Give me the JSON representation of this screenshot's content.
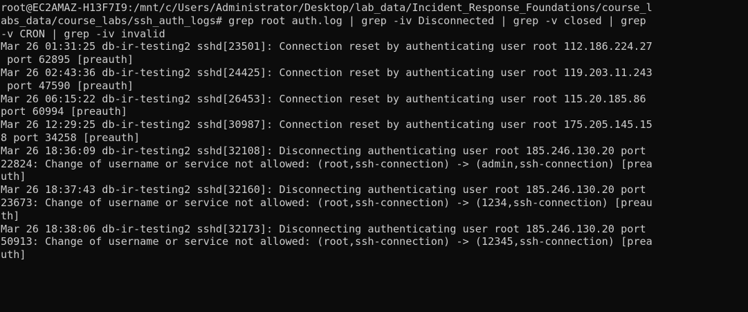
{
  "terminal": {
    "background": "#0c0c0c",
    "foreground": "#cccccc",
    "lines": [
      "root@EC2AMAZ-H13F7I9:/mnt/c/Users/Administrator/Desktop/lab_data/Incident_Response_Foundations/course_l",
      "abs_data/course_labs/ssh_auth_logs# grep root auth.log | grep -iv Disconnected | grep -v closed | grep",
      "-v CRON | grep -iv invalid",
      "Mar 26 01:31:25 db-ir-testing2 sshd[23501]: Connection reset by authenticating user root 112.186.224.27",
      " port 62895 [preauth]",
      "Mar 26 02:43:36 db-ir-testing2 sshd[24425]: Connection reset by authenticating user root 119.203.11.243",
      " port 47590 [preauth]",
      "Mar 26 06:15:22 db-ir-testing2 sshd[26453]: Connection reset by authenticating user root 115.20.185.86",
      "port 60994 [preauth]",
      "Mar 26 12:29:25 db-ir-testing2 sshd[30987]: Connection reset by authenticating user root 175.205.145.15",
      "8 port 34258 [preauth]",
      "Mar 26 18:36:09 db-ir-testing2 sshd[32108]: Disconnecting authenticating user root 185.246.130.20 port",
      "22824: Change of username or service not allowed: (root,ssh-connection) -> (admin,ssh-connection) [prea",
      "uth]",
      "Mar 26 18:37:43 db-ir-testing2 sshd[32160]: Disconnecting authenticating user root 185.246.130.20 port",
      "23673: Change of username or service not allowed: (root,ssh-connection) -> (1234,ssh-connection) [preau",
      "th]",
      "Mar 26 18:38:06 db-ir-testing2 sshd[32173]: Disconnecting authenticating user root 185.246.130.20 port",
      "50913: Change of username or service not allowed: (root,ssh-connection) -> (12345,ssh-connection) [prea",
      "uth]"
    ]
  }
}
